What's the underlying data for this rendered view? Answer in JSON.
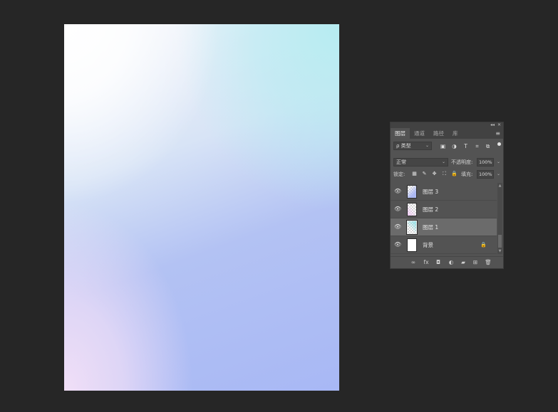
{
  "canvas": {
    "colors": {
      "top_left": "#ffffff",
      "top_right": "#b6ecf1",
      "bottom_left": "#f1dff7",
      "bottom_right": "#a8b8f5",
      "workspace": "#262626"
    }
  },
  "panel": {
    "header": {
      "collapse_icon": "collapse-icon",
      "close_icon": "close-icon",
      "collapse_glyph": "◂◂",
      "close_glyph": "✕"
    },
    "tabs": [
      {
        "label": "图层",
        "active": true
      },
      {
        "label": "通道",
        "active": false
      },
      {
        "label": "路径",
        "active": false
      },
      {
        "label": "库",
        "active": false
      }
    ],
    "menu_glyph": "≡",
    "filter": {
      "label": "ρ 类型",
      "icons": [
        "image-filter-icon",
        "adjustment-filter-icon",
        "type-filter-icon",
        "shape-filter-icon",
        "smart-object-filter-icon"
      ],
      "glyphs": [
        "▣",
        "◑",
        "T",
        "⌗",
        "⧉"
      ]
    },
    "blend": {
      "mode": "正常",
      "opacity_label": "不透明度:",
      "opacity_value": "100%"
    },
    "lock": {
      "label": "锁定:",
      "icons": [
        "lock-transparent-icon",
        "lock-paint-icon",
        "lock-position-icon",
        "lock-artboard-icon",
        "lock-all-icon"
      ],
      "glyphs": [
        "▦",
        "✎",
        "✥",
        "⛶",
        "🔒"
      ],
      "fill_label": "填充:",
      "fill_value": "100%"
    },
    "layers": [
      {
        "name": "图层 3",
        "visible": true,
        "selected": false,
        "thumb_color": "#a9b6f4"
      },
      {
        "name": "图层 2",
        "visible": true,
        "selected": false,
        "thumb_color": "#f1dff7"
      },
      {
        "name": "图层 1",
        "visible": true,
        "selected": true,
        "thumb_color": "#b6ecf1"
      },
      {
        "name": "背景",
        "visible": true,
        "selected": false,
        "locked": true,
        "thumb_color": "#ffffff"
      }
    ],
    "eye_glyph": "👁",
    "lock_glyph": "🔒",
    "bottom_icons": [
      "link-layers-icon",
      "fx-icon",
      "add-mask-icon",
      "adjustment-layer-icon",
      "group-folder-icon",
      "new-layer-icon",
      "delete-trash-icon"
    ],
    "bottom_glyphs": [
      "∞",
      "fx",
      "◘",
      "◐",
      "▰",
      "⊞",
      "🗑"
    ]
  }
}
